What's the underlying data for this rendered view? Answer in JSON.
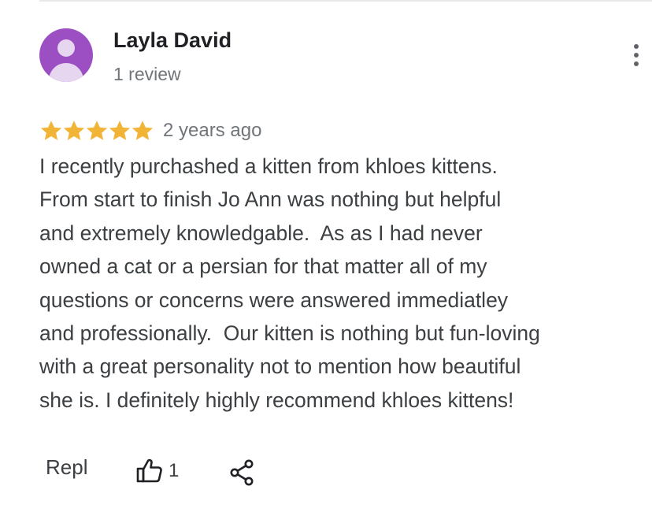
{
  "review": {
    "reviewer": {
      "name": "Layla David",
      "review_count": "1 review",
      "avatar_color": "#9c4fc2"
    },
    "rating": {
      "stars": 5,
      "max_stars": 5,
      "star_color": "#f2b437"
    },
    "date": "2 years ago",
    "text_lines": [
      "I recently purchashed a kitten from khloes kittens.",
      "From start to finish Jo Ann was nothing but helpful",
      "and extremely knowledgable.  As as I had never",
      "owned a cat or a persian for that matter all of my",
      "questions or concerns were answered immediatley",
      "and professionally.  Our kitten is nothing but fun-loving",
      "with a great personality not to mention how beautiful",
      "she is. I definitely highly recommend khloes kittens!"
    ],
    "actions": {
      "reply_label": "Reply",
      "like_count": "1",
      "like_icon": "thumbs-up-icon",
      "share_icon": "share-icon",
      "more_icon": "more-vertical-icon"
    }
  }
}
